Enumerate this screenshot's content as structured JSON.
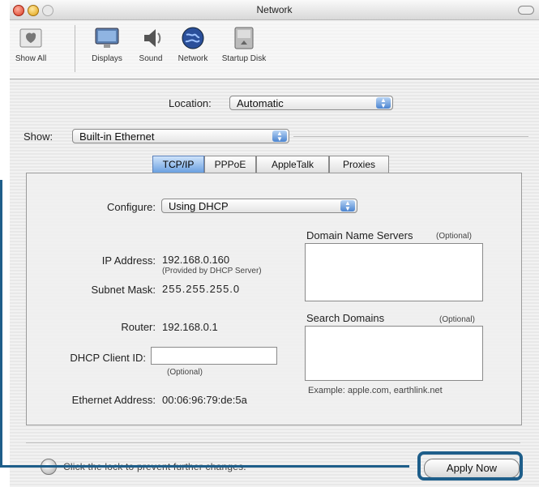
{
  "window": {
    "title": "Network"
  },
  "toolbar": {
    "items": [
      {
        "label": "Show All",
        "icon": "show-all-icon"
      },
      {
        "label": "Displays",
        "icon": "displays-icon"
      },
      {
        "label": "Sound",
        "icon": "sound-icon"
      },
      {
        "label": "Network",
        "icon": "network-icon"
      },
      {
        "label": "Startup Disk",
        "icon": "startup-disk-icon"
      }
    ]
  },
  "location": {
    "label": "Location:",
    "value": "Automatic"
  },
  "show": {
    "label": "Show:",
    "value": "Built-in Ethernet"
  },
  "tabs": [
    {
      "label": "TCP/IP",
      "selected": true
    },
    {
      "label": "PPPoE",
      "selected": false
    },
    {
      "label": "AppleTalk",
      "selected": false
    },
    {
      "label": "Proxies",
      "selected": false
    }
  ],
  "tcpip": {
    "configure_label": "Configure:",
    "configure_value": "Using DHCP",
    "ip_label": "IP Address:",
    "ip_value": "192.168.0.160",
    "ip_note": "(Provided by DHCP Server)",
    "subnet_label": "Subnet Mask:",
    "subnet_value": "255.255.255.0",
    "router_label": "Router:",
    "router_value": "192.168.0.1",
    "dhcp_client_label": "DHCP Client ID:",
    "dhcp_client_value": "",
    "dhcp_client_note": "(Optional)",
    "ethernet_label": "Ethernet Address:",
    "ethernet_value": "00:06:96:79:de:5a",
    "dns_label": "Domain Name Servers",
    "dns_optional": "(Optional)",
    "search_label": "Search Domains",
    "search_optional": "(Optional)",
    "example": "Example: apple.com, earthlink.net"
  },
  "footer": {
    "lock_text": "Click the lock to prevent further changes.",
    "apply_label": "Apply Now"
  },
  "colors": {
    "callout": "#1e5e8a",
    "accent": "#4a84d0"
  }
}
